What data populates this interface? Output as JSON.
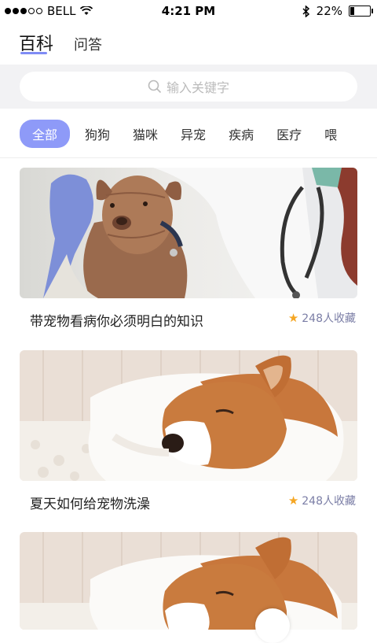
{
  "status_bar": {
    "carrier": "BELL",
    "time": "4:21 PM",
    "battery": "22%",
    "battery_level": 0.22
  },
  "top_tabs": {
    "baike": "百科",
    "wenda": "问答"
  },
  "search": {
    "placeholder": "输入关键字"
  },
  "categories": [
    "全部",
    "狗狗",
    "猫咪",
    "异宠",
    "疾病",
    "医疗",
    "喂"
  ],
  "articles": [
    {
      "title": "带宠物看病你必须明白的知识",
      "favorites": "248人收藏"
    },
    {
      "title": "夏天如何给宠物洗澡",
      "favorites": "248人收藏"
    }
  ],
  "colors": {
    "accent": "#8e9af8",
    "star": "#f5a623",
    "search_bg": "#f2f2f4"
  }
}
